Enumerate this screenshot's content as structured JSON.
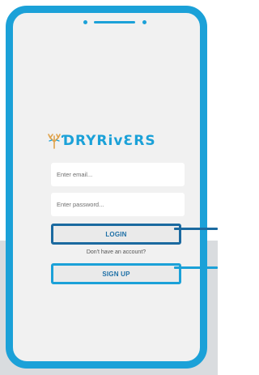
{
  "logo": {
    "text": "DRYRIVERS",
    "display_text": "ƊRYRivƐRS"
  },
  "form": {
    "email_placeholder": "Enter email...",
    "password_placeholder": "Enter password..."
  },
  "buttons": {
    "login_label": "LOGIN",
    "signup_label": "SIGN UP"
  },
  "signup_prompt": "Don't have an account?",
  "colors": {
    "accent": "#1ba1d8",
    "accent_dark": "#1b6aa0",
    "screen_background": "#f1f1f1"
  }
}
